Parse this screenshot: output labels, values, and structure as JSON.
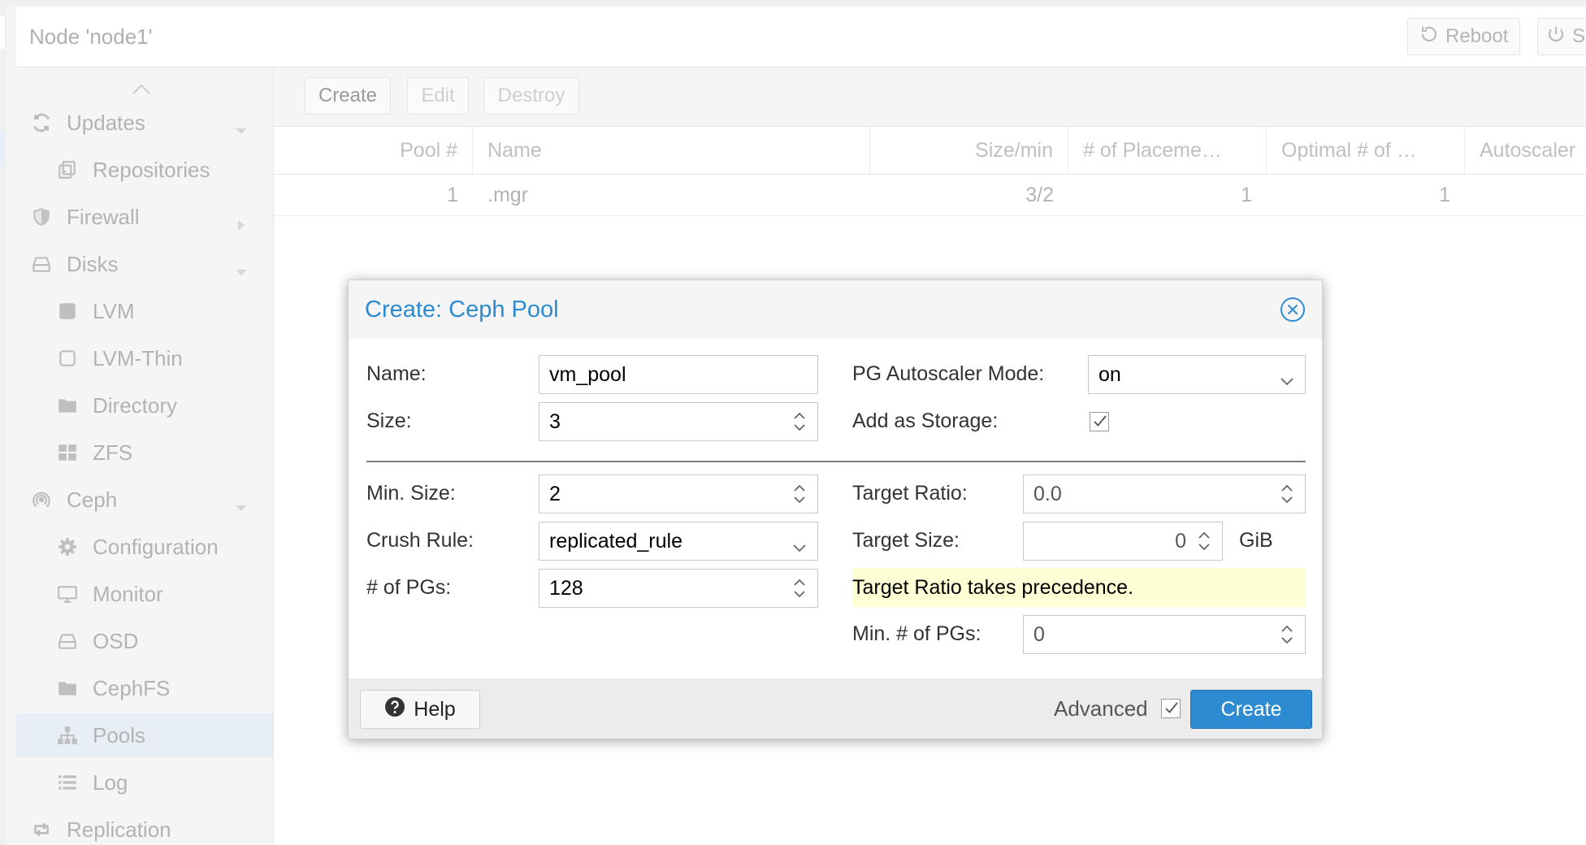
{
  "header": {
    "title": "Node 'node1'",
    "reboot_label": "Reboot",
    "shutdown_label": "S"
  },
  "nav": {
    "items": [
      {
        "label": "Updates",
        "icon": "refresh-icon",
        "caret": "down"
      },
      {
        "label": "Repositories",
        "icon": "repositories-icon"
      },
      {
        "label": "Firewall",
        "icon": "shield-icon",
        "caret": "right"
      },
      {
        "label": "Disks",
        "icon": "drive-icon",
        "caret": "down"
      },
      {
        "label": "LVM",
        "icon": "square-filled-icon"
      },
      {
        "label": "LVM-Thin",
        "icon": "square-outline-icon"
      },
      {
        "label": "Directory",
        "icon": "folder-icon"
      },
      {
        "label": "ZFS",
        "icon": "grid-icon"
      },
      {
        "label": "Ceph",
        "icon": "ceph-icon",
        "caret": "down"
      },
      {
        "label": "Configuration",
        "icon": "gear-icon"
      },
      {
        "label": "Monitor",
        "icon": "monitor-icon"
      },
      {
        "label": "OSD",
        "icon": "drive-icon"
      },
      {
        "label": "CephFS",
        "icon": "folder-icon"
      },
      {
        "label": "Pools",
        "icon": "sitemap-icon",
        "selected": true
      },
      {
        "label": "Log",
        "icon": "list-icon"
      },
      {
        "label": "Replication",
        "icon": "retweet-icon"
      }
    ]
  },
  "toolbar": {
    "create_label": "Create",
    "edit_label": "Edit",
    "destroy_label": "Destroy"
  },
  "table": {
    "columns": [
      "Pool #",
      "Name",
      "Size/min",
      "# of Placeme…",
      "Optimal # of …",
      "Autoscaler"
    ],
    "rows": [
      {
        "pool": "1",
        "name": ".mgr",
        "size_min": "3/2",
        "pgs": "1",
        "optimal": "1"
      }
    ]
  },
  "dialog": {
    "title": "Create: Ceph Pool",
    "name_label": "Name:",
    "name_value": "vm_pool",
    "size_label": "Size:",
    "size_value": "3",
    "autoscaler_label": "PG Autoscaler Mode:",
    "autoscaler_value": "on",
    "add_storage_label": "Add as Storage:",
    "add_storage_checked": true,
    "min_size_label": "Min. Size:",
    "min_size_value": "2",
    "crush_rule_label": "Crush Rule:",
    "crush_rule_value": "replicated_rule",
    "pgs_label": "# of PGs:",
    "pgs_value": "128",
    "target_ratio_label": "Target Ratio:",
    "target_ratio_value": "0.0",
    "target_size_label": "Target Size:",
    "target_size_value": "0",
    "target_size_unit": "GiB",
    "notice": "Target Ratio takes precedence.",
    "min_pgs_label": "Min. # of PGs:",
    "min_pgs_value": "0",
    "help_label": "Help",
    "advanced_label": "Advanced",
    "advanced_checked": true,
    "create_label": "Create"
  },
  "colors": {
    "accent": "#2d8bd1",
    "notice_bg": "#ffffd6",
    "selected_nav": "#e8eef6"
  }
}
